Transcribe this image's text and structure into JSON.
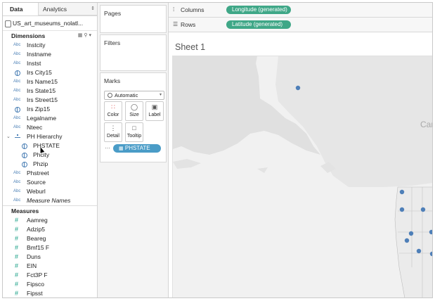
{
  "data_pane": {
    "tabs": {
      "data": "Data",
      "analytics": "Analytics"
    },
    "source": "US_art_museums_nolatl...",
    "dimensions_header": "Dimensions",
    "dimensions": [
      {
        "type": "Abc",
        "label": "Instcity"
      },
      {
        "type": "Abc",
        "label": "Instname"
      },
      {
        "type": "Abc",
        "label": "Instst"
      },
      {
        "type": "geo",
        "label": "Irs City15"
      },
      {
        "type": "Abc",
        "label": "Irs Name15"
      },
      {
        "type": "Abc",
        "label": "Irs State15"
      },
      {
        "type": "Abc",
        "label": "Irs Street15"
      },
      {
        "type": "geo",
        "label": "Irs Zip15"
      },
      {
        "type": "Abc",
        "label": "Legalname"
      },
      {
        "type": "Abc",
        "label": "Nteec"
      },
      {
        "type": "hier",
        "label": "PH Hierarchy"
      },
      {
        "type": "geo",
        "label": "PHSTATE",
        "child": true
      },
      {
        "type": "geo",
        "label": "Phcity",
        "child": true
      },
      {
        "type": "geo",
        "label": "Phzip",
        "child": true
      },
      {
        "type": "Abc",
        "label": "Phstreet"
      },
      {
        "type": "Abc",
        "label": "Source"
      },
      {
        "type": "Abc",
        "label": "Weburl"
      },
      {
        "type": "Abc",
        "label": "Measure Names",
        "italic": true
      }
    ],
    "measures_header": "Measures",
    "measures": [
      {
        "label": "Aamreg"
      },
      {
        "label": "Adzip5"
      },
      {
        "label": "Beareg"
      },
      {
        "label": "Bmf15 F"
      },
      {
        "label": "Duns"
      },
      {
        "label": "EIN"
      },
      {
        "label": "Fct3P F"
      },
      {
        "label": "Fipsco"
      },
      {
        "label": "Fipsst"
      }
    ],
    "icons": {
      "abc": "Abc",
      "measure": "#"
    }
  },
  "cards": {
    "pages": "Pages",
    "filters": "Filters",
    "marks": "Marks",
    "mark_type": "Automatic",
    "buttons": {
      "color": "Color",
      "size": "Size",
      "label": "Label",
      "detail": "Detail",
      "tooltip": "Tooltip"
    },
    "detail_pill": "PHSTATE"
  },
  "shelves": {
    "columns_label": "Columns",
    "columns_pill": "Longitude (generated)",
    "rows_label": "Rows",
    "rows_pill": "Latitude (generated)"
  },
  "sheet": {
    "title": "Sheet 1",
    "map_label": "Can",
    "point_color": "#4e7fb8"
  }
}
